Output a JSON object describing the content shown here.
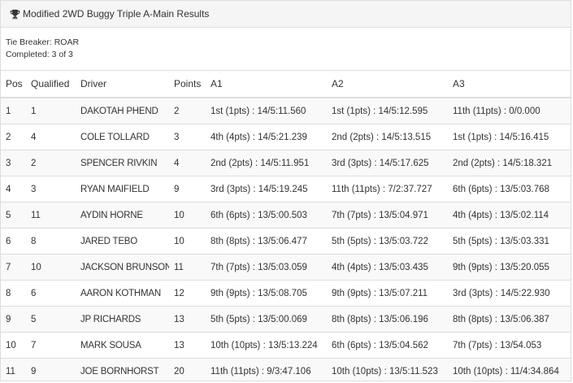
{
  "panel": {
    "title": "Modified 2WD Buggy Triple A-Main Results",
    "tie_breaker": "Tie Breaker: ROAR",
    "completed": "Completed: 3 of 3"
  },
  "table": {
    "headers": {
      "pos": "Pos",
      "qualified": "Qualified",
      "driver": "Driver",
      "points": "Points",
      "a1": "A1",
      "a2": "A2",
      "a3": "A3"
    },
    "rows": [
      {
        "pos": "1",
        "qualified": "1",
        "driver": "DAKOTAH PHEND",
        "points": "2",
        "a1": "1st (1pts) : 14/5:11.560",
        "a2": "1st (1pts) : 14/5:12.595",
        "a3": "11th (11pts) : 0/0.000"
      },
      {
        "pos": "2",
        "qualified": "4",
        "driver": "COLE TOLLARD",
        "points": "3",
        "a1": "4th (4pts) : 14/5:21.239",
        "a2": "2nd (2pts) : 14/5:13.515",
        "a3": "1st (1pts) : 14/5:16.415"
      },
      {
        "pos": "3",
        "qualified": "2",
        "driver": "SPENCER RIVKIN",
        "points": "4",
        "a1": "2nd (2pts) : 14/5:11.951",
        "a2": "3rd (3pts) : 14/5:17.625",
        "a3": "2nd (2pts) : 14/5:18.321"
      },
      {
        "pos": "4",
        "qualified": "3",
        "driver": "RYAN MAIFIELD",
        "points": "9",
        "a1": "3rd (3pts) : 14/5:19.245",
        "a2": "11th (11pts) : 7/2:37.727",
        "a3": "6th (6pts) : 13/5:03.768"
      },
      {
        "pos": "5",
        "qualified": "11",
        "driver": "AYDIN HORNE",
        "points": "10",
        "a1": "6th (6pts) : 13/5:00.503",
        "a2": "7th (7pts) : 13/5:04.971",
        "a3": "4th (4pts) : 13/5:02.114"
      },
      {
        "pos": "6",
        "qualified": "8",
        "driver": "JARED TEBO",
        "points": "10",
        "a1": "8th (8pts) : 13/5:06.477",
        "a2": "5th (5pts) : 13/5:03.722",
        "a3": "5th (5pts) : 13/5:03.331"
      },
      {
        "pos": "7",
        "qualified": "10",
        "driver": "JACKSON BRUNSON",
        "points": "11",
        "a1": "7th (7pts) : 13/5:03.059",
        "a2": "4th (4pts) : 13/5:03.435",
        "a3": "9th (9pts) : 13/5:20.055"
      },
      {
        "pos": "8",
        "qualified": "6",
        "driver": "AARON KOTHMAN",
        "points": "12",
        "a1": "9th (9pts) : 13/5:08.705",
        "a2": "9th (9pts) : 13/5:07.211",
        "a3": "3rd (3pts) : 14/5:22.930"
      },
      {
        "pos": "9",
        "qualified": "5",
        "driver": "JP RICHARDS",
        "points": "13",
        "a1": "5th (5pts) : 13/5:00.069",
        "a2": "8th (8pts) : 13/5:06.196",
        "a3": "8th (8pts) : 13/5:06.387"
      },
      {
        "pos": "10",
        "qualified": "7",
        "driver": "MARK SOUSA",
        "points": "13",
        "a1": "10th (10pts) : 13/5:13.224",
        "a2": "6th (6pts) : 13/5:04.562",
        "a3": "7th (7pts) : 13/54.053"
      },
      {
        "pos": "11",
        "qualified": "9",
        "driver": "JOE BORNHORST",
        "points": "20",
        "a1": "11th (11pts) : 9/3:47.106",
        "a2": "10th (10pts) : 13/5:11.523",
        "a3": "10th (10pts) : 11/4:34.864"
      }
    ]
  },
  "icons": {
    "title_icon": "trophy-icon"
  },
  "colors": {
    "header_bg": "#f5f5f5",
    "stripe_bg": "#f9f9f9",
    "border": "#dddddd",
    "text": "#333333"
  }
}
